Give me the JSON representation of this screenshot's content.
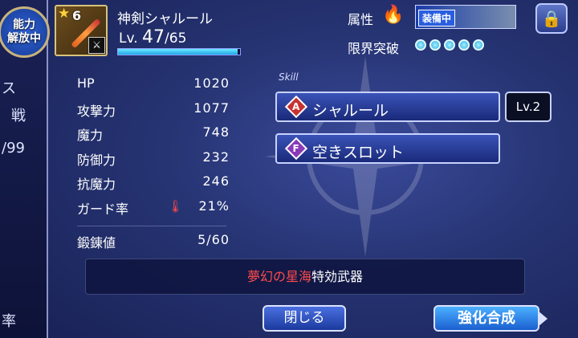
{
  "badge": {
    "line1": "能力",
    "line2": "解放中"
  },
  "left_fragments": [
    "ス",
    "戦",
    "/99",
    "率"
  ],
  "weapon": {
    "rarity": "6",
    "name": "神剣シャルール",
    "lv_prefix": "Lv.",
    "lv_current": "47",
    "lv_max": "/65",
    "exp_fill": 0.98
  },
  "header": {
    "attr_label": "属性",
    "attr_icon": "fire-icon",
    "equip_tag": "装備中",
    "limit_label": "限界突破",
    "limit_dots": 5,
    "lock_icon": "lock-icon"
  },
  "stats": [
    {
      "label": "HP",
      "value": "1020"
    },
    {
      "label": "攻撃力",
      "value": "1077"
    },
    {
      "label": "魔力",
      "value": "748"
    },
    {
      "label": "防御力",
      "value": "232"
    },
    {
      "label": "抗魔力",
      "value": "246"
    },
    {
      "label": "ガード率",
      "value": "21%",
      "indicator": "thermometer-icon"
    }
  ],
  "forge": {
    "label": "鍛錬値",
    "value": "5/60"
  },
  "skill": {
    "section_label": "Skill",
    "slots": [
      {
        "icon_letter": "A",
        "label": "シャルール",
        "icon_color": "#c83232"
      },
      {
        "icon_letter": "F",
        "label": "空きスロット",
        "icon_color": "#8a3ab8"
      }
    ],
    "level": "Lv.2"
  },
  "effect": {
    "highlight": "夢幻の星海",
    "text": "特効武器"
  },
  "buttons": {
    "close": "閉じる",
    "enhance": "強化合成"
  },
  "colors": {
    "accent_red": "#ff4a4a",
    "panel": "#263473",
    "exp": "#1fa6e6"
  }
}
